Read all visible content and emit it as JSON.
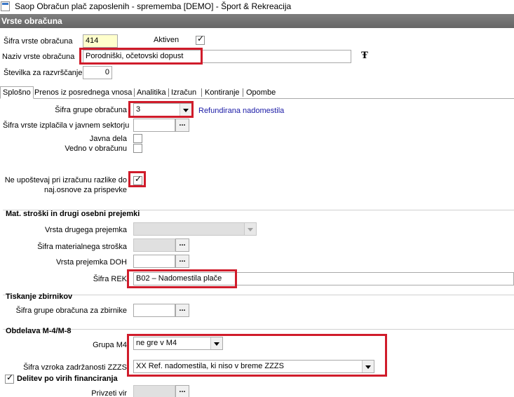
{
  "window": {
    "title": "Saop Obračun plač zaposlenih - sprememba [DEMO] - Šport & Rekreacija"
  },
  "header": {
    "title": "Vrste obračuna"
  },
  "top": {
    "sifra_label": "Šifra vrste obračuna",
    "sifra_value": "414",
    "aktiven_label": "Aktiven",
    "naziv_label": "Naziv vrste obračuna",
    "naziv_value": "Porodniški, očetovski dopust",
    "stevilka_label": "Številka  za razvrščanje",
    "stevilka_value": "0"
  },
  "tabs": [
    {
      "label": "Splošno"
    },
    {
      "label": "Prenos iz posrednega vnosa"
    },
    {
      "label": "Analitika"
    },
    {
      "label": "Izračun"
    },
    {
      "label": "Kontiranje"
    },
    {
      "label": "Opombe"
    }
  ],
  "general": {
    "grupa_label": "Šifra grupe obračuna",
    "grupa_value": "3",
    "grupa_desc": "Refundirana nadomestila",
    "izplacilo_label": "Šifra vrste izplačila v javnem sektorju",
    "javna_dela_label": "Javna dela",
    "vedno_label": "Vedno v obračunu",
    "neupostevaj_label_1": "Ne upoštevaj pri izračunu razlike do",
    "neupostevaj_label_2": "naj.osnove za prispevke"
  },
  "mat": {
    "title": "Mat. stroški in drugi osebni prejemki",
    "vrsta_drugega_label": "Vrsta drugega prejemka",
    "sifra_mat_label": "Šifra materialnega stroška",
    "vrsta_doh_label": "Vrsta prejemka DOH",
    "sifra_rek_label": "Šifra REK",
    "sifra_rek_value": "B02 – Nadomestila plače"
  },
  "tiskanje": {
    "title": "Tiskanje zbirnikov",
    "zbirnik_label": "Šifra grupe obračuna za zbirnike"
  },
  "m4": {
    "title": "Obdelava M-4/M-8",
    "grupa_label": "Grupa M4",
    "grupa_value": "ne gre v M4",
    "zzzs_label": "Šifra vzroka zadržanosti ZZZS",
    "zzzs_value": "XX Ref. nadomestila, ki niso v breme ZZZS"
  },
  "delitev": {
    "title": "Delitev po virih financiranja",
    "privzeti_label": "Privzeti vir"
  },
  "icons": {
    "ellipsis": "...",
    "check": "✓",
    "format": "Ŧ"
  }
}
